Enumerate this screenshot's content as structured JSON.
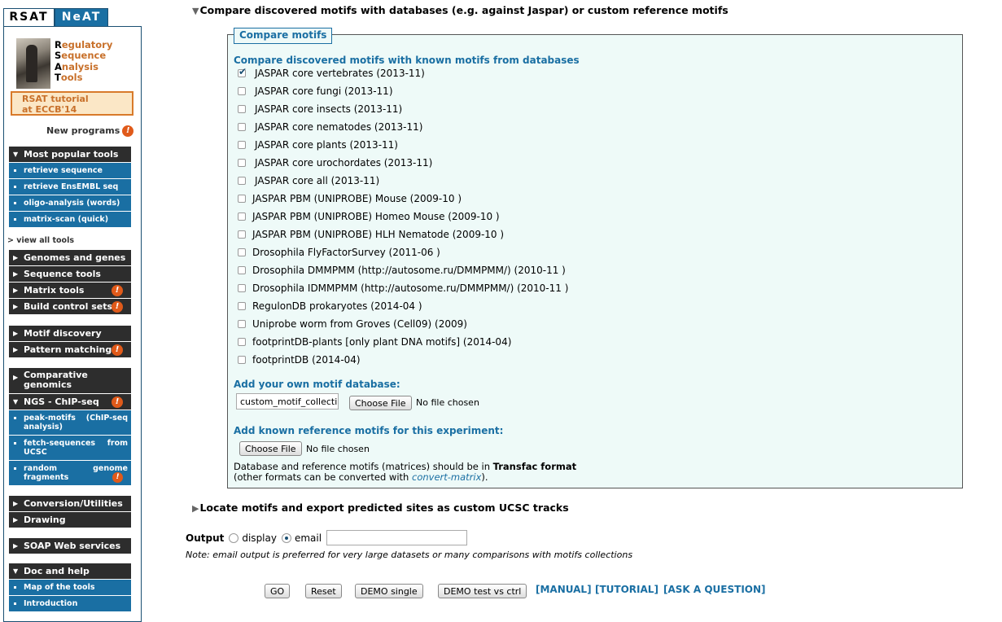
{
  "tabs": {
    "rsat": "RSAT",
    "neat": "NeAT"
  },
  "logo": {
    "line1_initial": "R",
    "line1_rest": "egulatory",
    "line2_initial": "S",
    "line2_rest": "equence",
    "line3_initial": "A",
    "line3_rest": "nalysis",
    "line4_initial": "T",
    "line4_rest": "ools"
  },
  "tutorial": {
    "line1": "RSAT tutorial",
    "line2": "at ECCB'14"
  },
  "new_programs": "New programs",
  "warn_glyph": "!",
  "menu": {
    "popular": {
      "header": "Most popular tools",
      "items": [
        "retrieve sequence",
        "retrieve EnsEMBL seq",
        "oligo-analysis (words)",
        "matrix-scan (quick)"
      ]
    },
    "view_all": "> view all tools",
    "group1": [
      "Genomes and genes",
      "Sequence tools",
      "Matrix tools",
      "Build control sets"
    ],
    "group2": [
      "Motif discovery",
      "Pattern matching"
    ],
    "group3": {
      "comparative": "Comparative genomics",
      "ngs": "NGS - ChIP-seq",
      "items": [
        {
          "a": "peak-motifs",
          "b": "(ChIP-seq",
          "c": "analysis)"
        },
        {
          "a": "fetch-sequences",
          "b": "from",
          "c": "UCSC"
        },
        {
          "a": "random",
          "b": "genome",
          "c": "fragments"
        }
      ]
    },
    "group4": [
      "Conversion/Utilities",
      "Drawing"
    ],
    "group5": [
      "SOAP Web services"
    ],
    "group6": {
      "header": "Doc and help",
      "items": [
        "Map of the tools",
        "Introduction"
      ]
    }
  },
  "main": {
    "compare_section": "Compare discovered motifs with databases (e.g. against Jaspar) or custom reference motifs",
    "legend": "Compare motifs",
    "db_heading": "Compare discovered motifs with known motifs from databases",
    "databases": [
      {
        "label": "JASPAR core vertebrates (2013-11)",
        "checked": true
      },
      {
        "label": "JASPAR core fungi (2013-11)",
        "checked": false
      },
      {
        "label": "JASPAR core insects (2013-11)",
        "checked": false
      },
      {
        "label": "JASPAR core nematodes (2013-11)",
        "checked": false
      },
      {
        "label": "JASPAR core plants (2013-11)",
        "checked": false
      },
      {
        "label": "JASPAR core urochordates (2013-11)",
        "checked": false
      },
      {
        "label": "JASPAR core all (2013-11)",
        "checked": false
      },
      {
        "label": "JASPAR PBM (UNIPROBE) Mouse (2009-10 )",
        "checked": false
      },
      {
        "label": "JASPAR PBM (UNIPROBE) Homeo Mouse (2009-10 )",
        "checked": false
      },
      {
        "label": "JASPAR PBM (UNIPROBE) HLH Nematode (2009-10 )",
        "checked": false
      },
      {
        "label": "Drosophila FlyFactorSurvey (2011-06 )",
        "checked": false
      },
      {
        "label": "Drosophila DMMPMM (http://autosome.ru/DMMPMM/) (2010-11 )",
        "checked": false
      },
      {
        "label": "Drosophila IDMMPMM (http://autosome.ru/DMMPMM/) (2010-11 )",
        "checked": false
      },
      {
        "label": "RegulonDB prokaryotes (2014-04 )",
        "checked": false
      },
      {
        "label": "Uniprobe worm from Groves (Cell09) (2009)",
        "checked": false
      },
      {
        "label": "footprintDB-plants [only plant DNA motifs] (2014-04)",
        "checked": false
      },
      {
        "label": "footprintDB (2014-04)",
        "checked": false
      }
    ],
    "own_db_heading": "Add your own motif database:",
    "own_db_value": "custom_motif_collecti",
    "choose_file": "Choose File",
    "no_file": "No file chosen",
    "ref_heading": "Add known reference motifs for this experiment:",
    "format_note_pre": "Database and reference motifs (matrices) should be in ",
    "format_note_bold": "Transfac format",
    "format_note_line2_pre": "(other formats can be converted with ",
    "format_note_link": "convert-matrix",
    "format_note_line2_post": ").",
    "locate_section": "Locate motifs and export predicted sites as custom UCSC tracks",
    "output_label": "Output",
    "output_display": "display",
    "output_email": "email",
    "email_value": "",
    "note": "Note: email output is preferred for very large datasets or many comparisons with motifs collections",
    "buttons": {
      "go": "GO",
      "reset": "Reset",
      "demo_single": "DEMO single",
      "demo_test": "DEMO test vs ctrl"
    },
    "links": {
      "manual": "[MANUAL]",
      "tutorial": "[TUTORIAL]",
      "ask": "[ASK A QUESTION]"
    }
  }
}
